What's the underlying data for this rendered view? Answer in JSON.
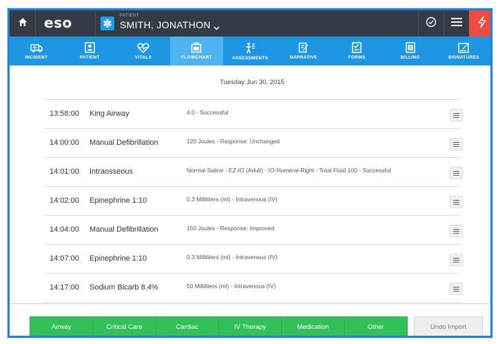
{
  "topbar": {
    "logo": "eso",
    "patient_caption": "PATIENT",
    "patient_name": "SMITH, JONATHON",
    "icons": [
      "home-icon",
      "star-of-life-icon",
      "chevron-down-icon",
      "check-circle-icon",
      "hamburger-menu-icon",
      "alert-flash-icon"
    ]
  },
  "nav": {
    "items": [
      {
        "label": "INCIDENT",
        "icon": "ambulance-icon"
      },
      {
        "label": "PATIENT",
        "icon": "patient-card-icon"
      },
      {
        "label": "VITALS",
        "icon": "heartbeat-icon"
      },
      {
        "label": "FLOWCHART",
        "icon": "flowchart-icon",
        "active": true
      },
      {
        "label": "ASSESSMENTS",
        "icon": "body-icon"
      },
      {
        "label": "NARRATIVE",
        "icon": "pencil-doc-icon"
      },
      {
        "label": "FORMS",
        "icon": "forms-icon"
      },
      {
        "label": "BILLING",
        "icon": "billing-icon"
      },
      {
        "label": "SIGNATURES",
        "icon": "signature-icon"
      }
    ]
  },
  "flowchart": {
    "date": "Tuesday Jun 30, 2015",
    "rows": [
      {
        "time": "13:58:00",
        "name": "King Airway",
        "detail": "4.0 - Successful"
      },
      {
        "time": "14:00:00",
        "name": "Manual Defibrillation",
        "detail": "120 Joules - Response: Unchanged"
      },
      {
        "time": "14:01:00",
        "name": "Intraosseous",
        "detail": "Normal Saline - EZ-IO (Adult) - IO-Humeral-Right - Total Fluid 100 - Successful"
      },
      {
        "time": "14:02:00",
        "name": "Epinephrine 1:10",
        "detail": "0.3 Milliliters (ml) - Intravenous (IV)"
      },
      {
        "time": "14:04:00",
        "name": "Manual Defibrillation",
        "detail": "150 Joules - Response: Improved"
      },
      {
        "time": "14:07:00",
        "name": "Epinephrine 1:10",
        "detail": "0.3 Milliliters (ml) - Intravenous (IV)"
      },
      {
        "time": "14:17:00",
        "name": "Sodium Bicarb 8.4%",
        "detail": "50 Milliliters (ml) - Intravenous (IV)"
      }
    ]
  },
  "bottom": {
    "categories": [
      "Airway",
      "Critical Care",
      "Cardiac",
      "IV Therapy",
      "Medication",
      "Other"
    ],
    "undo_label": "Undo Import"
  },
  "colors": {
    "topbar": "#333b47",
    "nav": "#1e96e4",
    "nav_active": "#4bb3f0",
    "category_green": "#33c05a",
    "alert_red": "#ef4b3f",
    "frame_border": "#2a7fd1"
  }
}
